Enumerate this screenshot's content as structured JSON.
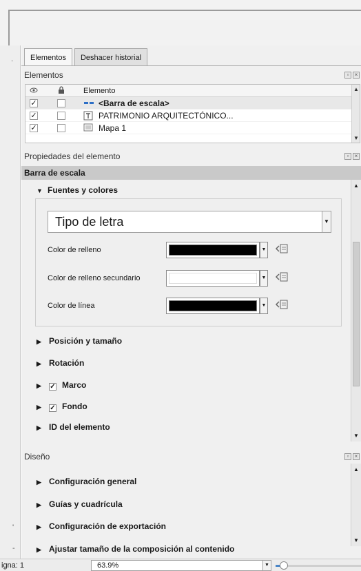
{
  "tabs": [
    "Elementos",
    "Deshacer historial"
  ],
  "elements_panel": {
    "title": "Elementos",
    "columns": {
      "visibility_icon": "eye-icon",
      "lock_icon": "lock-icon",
      "element": "Elemento"
    },
    "rows": [
      {
        "visible": true,
        "locked": false,
        "icon": "scalebar-icon",
        "label": "<Barra de escala>",
        "selected": true
      },
      {
        "visible": true,
        "locked": false,
        "icon": "text-icon",
        "label": "PATRIMONIO ARQUITECTÓNICO...",
        "selected": false
      },
      {
        "visible": true,
        "locked": false,
        "icon": "map-icon",
        "label": "Mapa 1",
        "selected": false
      }
    ]
  },
  "properties": {
    "header": "Propiedades del elemento",
    "title": "Barra de escala",
    "fonts_group": {
      "label": "Fuentes y colores",
      "font_button": "Tipo de letra",
      "colors": [
        {
          "label": "Color de relleno",
          "color": "#000000"
        },
        {
          "label": "Color de relleno secundario",
          "color": "#ffffff"
        },
        {
          "label": "Color de línea",
          "color": "#000000"
        }
      ]
    },
    "sections": [
      {
        "label": "Posición y tamaño",
        "checkbox": null
      },
      {
        "label": "Rotación",
        "checkbox": null
      },
      {
        "label": "Marco",
        "checkbox": true
      },
      {
        "label": "Fondo",
        "checkbox": true
      },
      {
        "label": "ID del elemento",
        "checkbox": null
      }
    ]
  },
  "layout_panel": {
    "title": "Diseño",
    "sections": [
      "Configuración general",
      "Guías y cuadrícula",
      "Configuración de exportación",
      "Ajustar tamaño de la composición al contenido"
    ]
  },
  "status": {
    "page_label": "igna: 1",
    "zoom": "63.9%",
    "zoom_slider_fraction": 0.1
  },
  "symbols": {
    "check": "✓",
    "collapsed": "▶",
    "expanded": "▼",
    "dropdown": "▼"
  }
}
